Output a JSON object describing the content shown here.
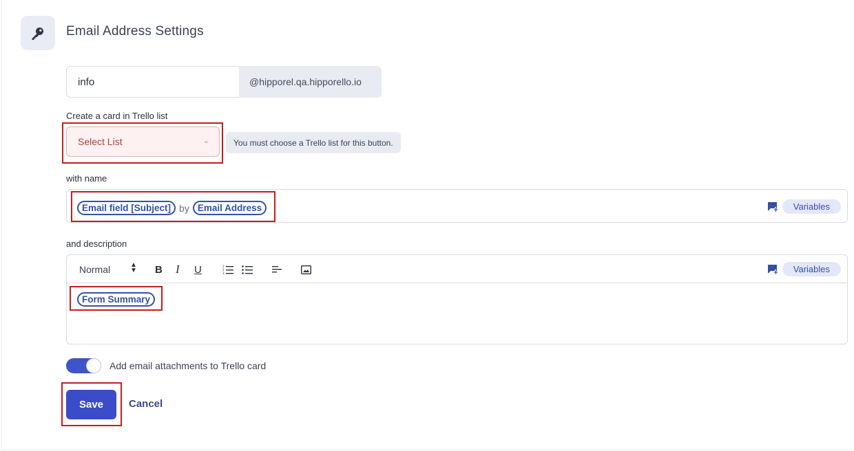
{
  "header": {
    "title": "Email Address Settings",
    "icon": "key-icon"
  },
  "email": {
    "local_part": "info",
    "domain_suffix": "@hipporel.qa.hipporello.io"
  },
  "trello_list": {
    "label": "Create a card in Trello list",
    "select_placeholder": "Select List",
    "warning": "You must choose a Trello list for this button."
  },
  "name_section": {
    "label": "with name",
    "tokens": [
      "Email field [Subject]",
      "Email Address"
    ],
    "joiner": "by",
    "variables_label": "Variables"
  },
  "description_section": {
    "label": "and description",
    "toolbar": {
      "text_style": "Normal",
      "bold": "B",
      "italic": "I",
      "underline": "U"
    },
    "variables_label": "Variables",
    "token": "Form Summary"
  },
  "attachments": {
    "label": "Add email attachments to Trello card",
    "enabled": true
  },
  "actions": {
    "save_label": "Save",
    "cancel_label": "Cancel"
  },
  "colors": {
    "accent": "#3a4cc8",
    "highlight": "#c81b1b",
    "error_bg": "#fdf1f1"
  }
}
